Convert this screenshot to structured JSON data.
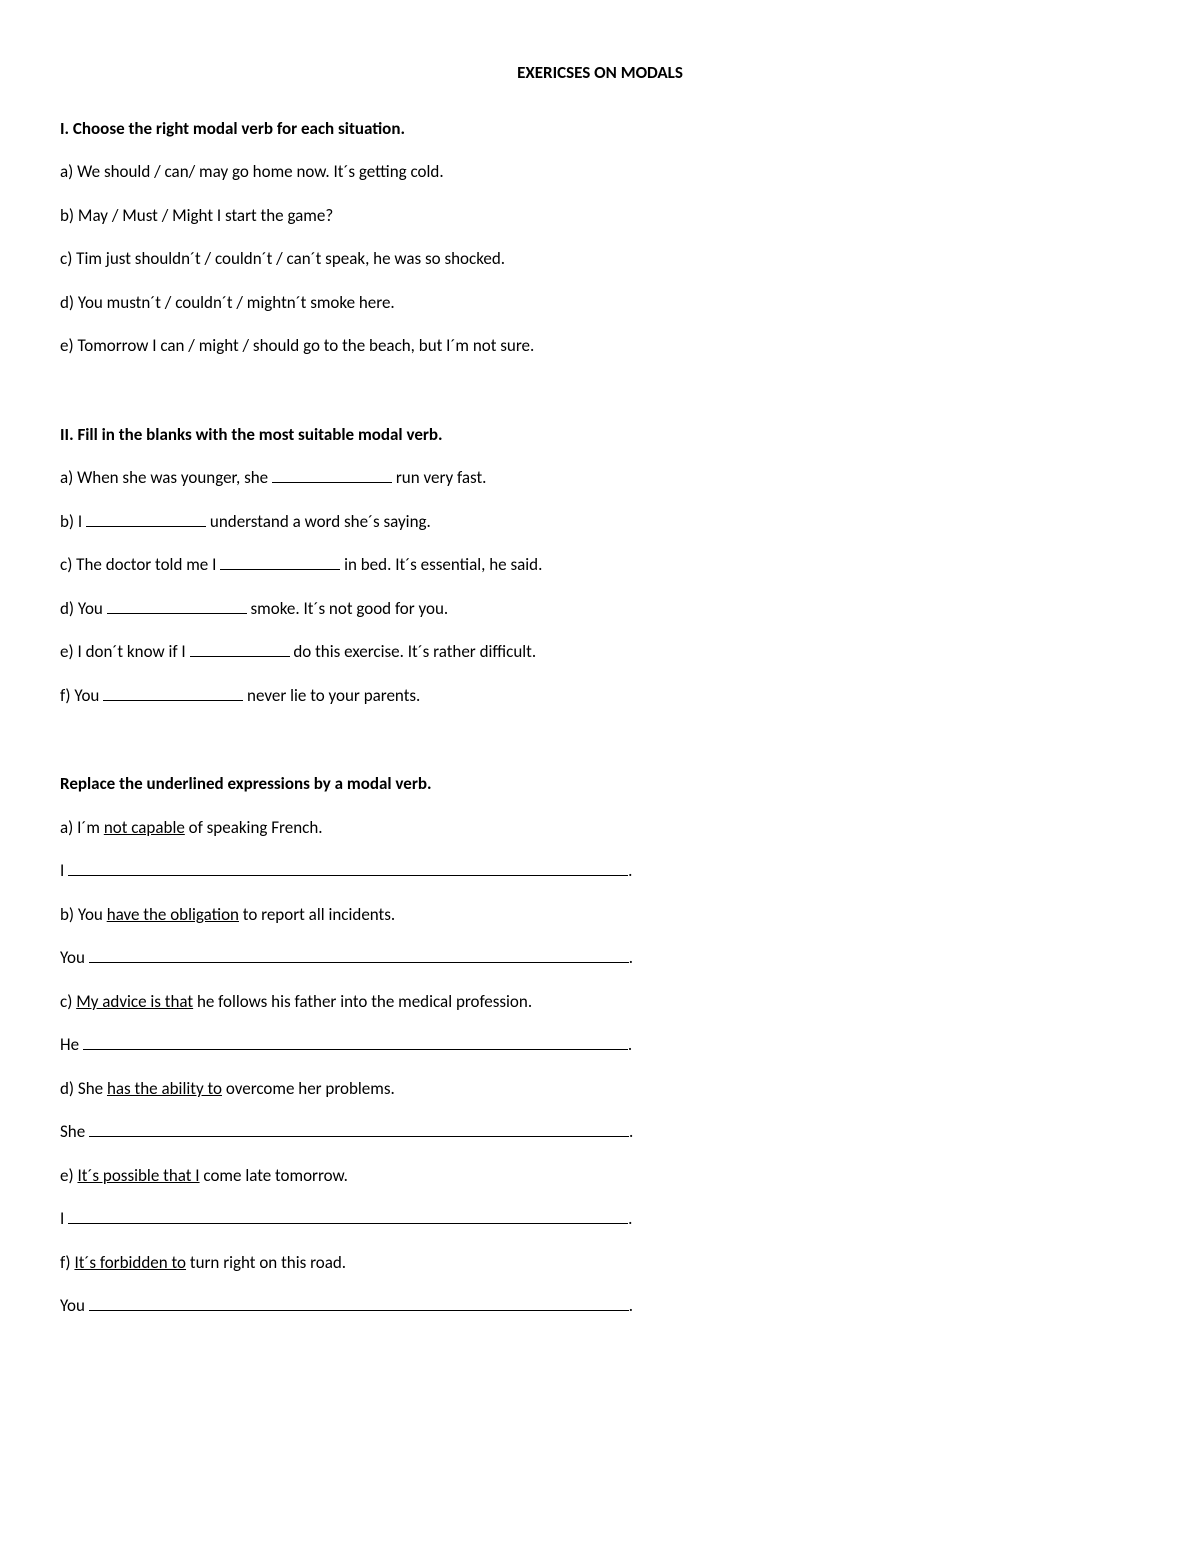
{
  "title": "EXERICSES ON MODALS",
  "section1": {
    "heading": "I. Choose the right modal verb for each situation.",
    "a": "a) We should / can/ may go home now. It´s getting cold.",
    "b": "b) May / Must / Might I start the game?",
    "c": "c) Tim just shouldn´t / couldn´t / can´t speak, he was so shocked.",
    "d": "d) You mustn´t / couldn´t / mightn´t smoke here.",
    "e": "e) Tomorrow I can / might / should go to the beach, but I´m not sure."
  },
  "section2": {
    "heading": "II. Fill in the blanks with the most suitable modal verb.",
    "a_pre": "a) When she was younger, she ",
    "a_post": " run very fast.",
    "b_pre": "b) I ",
    "b_post": " understand a word she´s saying.",
    "c_pre": "c) The doctor told me I ",
    "c_post": " in bed. It´s essential, he said.",
    "d_pre": "d) You ",
    "d_post": " smoke. It´s not good for you.",
    "e_pre": "e) I don´t know if I ",
    "e_post": " do this exercise. It´s rather difficult.",
    "f_pre": "f) You ",
    "f_post": " never lie to your parents."
  },
  "section3": {
    "heading": "Replace the underlined expressions by a modal verb.",
    "a_pre": "a) I´m ",
    "a_u": "not capable",
    "a_post": " of speaking French.",
    "a_ans_pre": "I ",
    "a_ans_post": ".",
    "b_pre": "b) You ",
    "b_u": "have the obligation",
    "b_post": " to report all incidents.",
    "b_ans_pre": "You ",
    "b_ans_post": ".",
    "c_pre": "c) ",
    "c_u": "My advice is that",
    "c_post": " he follows his father into the medical profession.",
    "c_ans_pre": "He ",
    "c_ans_post": ".",
    "d_pre": "d) She ",
    "d_u": "has the ability to",
    "d_post": " overcome her problems.",
    "d_ans_pre": "She ",
    "d_ans_post": ".",
    "e_pre": "e) ",
    "e_u": "It´s possible that I",
    "e_post": " come late tomorrow.",
    "e_ans_pre": "I ",
    "e_ans_post": ".",
    "f_pre": "f) ",
    "f_u": "It´s forbidden to",
    "f_post": " turn right on this road.",
    "f_ans_pre": "You ",
    "f_ans_post": "."
  }
}
